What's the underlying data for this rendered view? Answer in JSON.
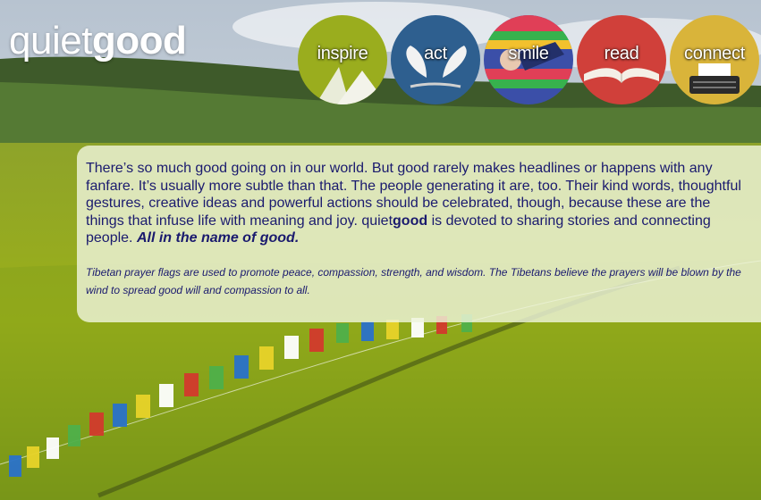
{
  "brand": {
    "part1": "quiet",
    "part2": "good"
  },
  "nav": [
    {
      "label": "inspire",
      "icon": "mountain-icon",
      "color": "#9aad1e"
    },
    {
      "label": "act",
      "icon": "wings-icon",
      "color": "#2e5f8f"
    },
    {
      "label": "smile",
      "icon": "person-smiling-icon",
      "color": "#3b4fa8"
    },
    {
      "label": "read",
      "icon": "open-book-icon",
      "color": "#d0403a"
    },
    {
      "label": "connect",
      "icon": "typewriter-icon",
      "color": "#d9b43a"
    }
  ],
  "intro": {
    "text_before": "There’s so much good going on in our world. But good rarely makes headlines or happens with any fanfare. It’s usually more subtle than that. The people generating it are, too. Their kind words, thoughtful gestures, creative ideas and powerful actions should be celebrated, though, because these are the things that infuse life with meaning and joy. quiet",
    "brand_bold": "good",
    "text_after": " is devoted to sharing stories and connecting people. ",
    "tagline": "All in the name of good."
  },
  "caption": "Tibetan prayer flags are used to promote peace, compassion, strength, and wisdom. The Tibetans believe the prayers will be blown by the wind to spread good will and compassion to all."
}
